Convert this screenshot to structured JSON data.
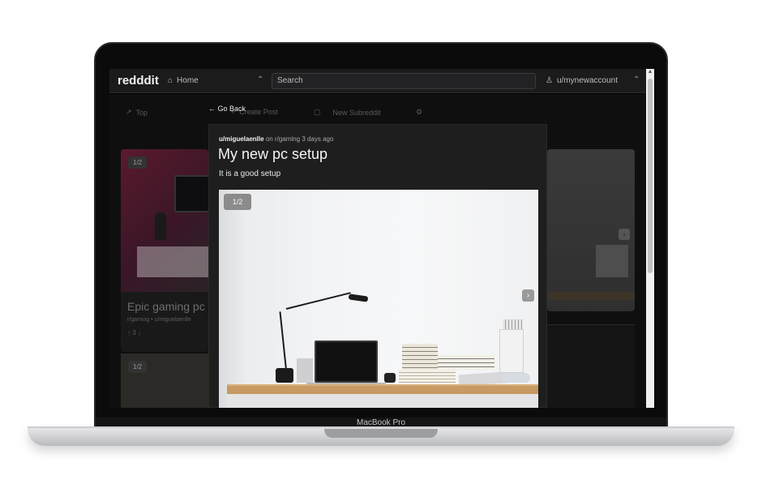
{
  "device": {
    "brand_label": "MacBook Pro"
  },
  "navbar": {
    "logo": "redddit",
    "home_label": "Home",
    "search_placeholder": "Search",
    "user_label": "u/mynewaccount"
  },
  "background": {
    "nav": [
      {
        "label": "Top",
        "icon": "trending-icon"
      },
      {
        "label": "Create Post",
        "icon": "plus-icon"
      },
      {
        "label": "New Subreddit",
        "icon": "chat-icon"
      },
      {
        "label": "",
        "icon": "settings-icon"
      }
    ],
    "card_left": {
      "counter": "1/2",
      "title": "Epic gaming pc",
      "subreddit": "r/gaming",
      "author": "u/miguelaenlle",
      "votes": "3"
    },
    "card_left2": {
      "counter": "1/2"
    }
  },
  "modal": {
    "go_back_label": "Go Back",
    "author": "u/miguelaenlle",
    "on_text": "on",
    "subreddit": "r/gaming",
    "time": "3 days ago",
    "title": "My new pc setup",
    "body": "It is a good setup",
    "image_counter": "1/2"
  },
  "colors": {
    "background": "#000000",
    "panel": "#1e1e1f",
    "navbar": "#1b1b1c",
    "text": "#f5f5f5"
  }
}
